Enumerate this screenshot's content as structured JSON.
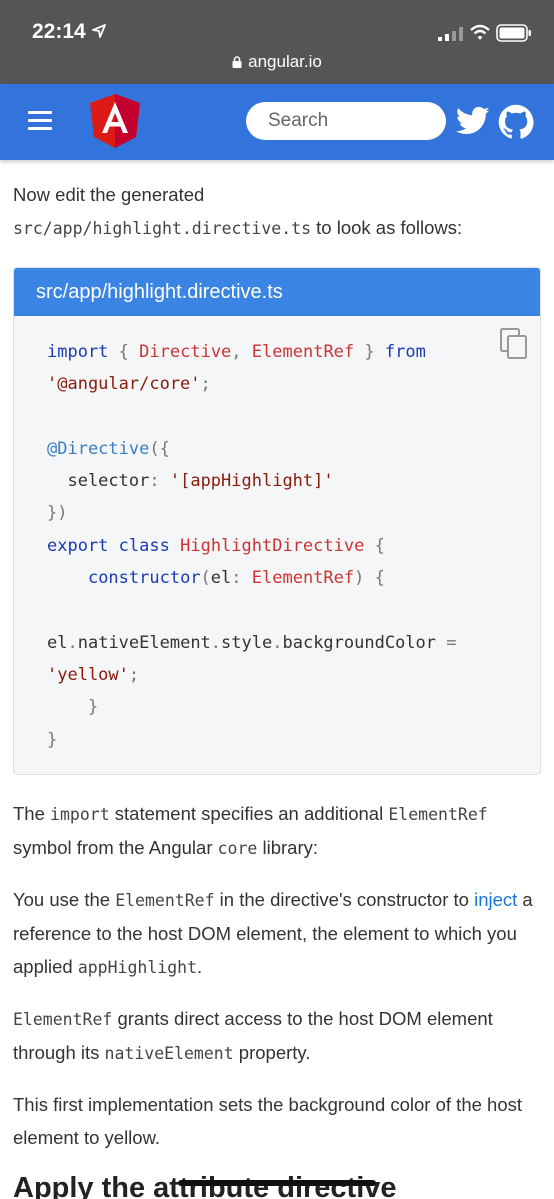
{
  "status": {
    "time": "22:14",
    "url": "angular.io"
  },
  "nav": {
    "search_placeholder": "Search"
  },
  "intro": {
    "text1": "Now edit the generated",
    "code": "src/app/highlight.directive.ts",
    "text2": " to look as follows:"
  },
  "code_block": {
    "title": "src/app/highlight.directive.ts",
    "lines": [
      "import { Directive, ElementRef } from",
      "'@angular/core';",
      "",
      "@Directive({",
      "  selector: '[appHighlight]'",
      "})",
      "export class HighlightDirective {",
      "    constructor(el: ElementRef) {",
      "",
      "el.nativeElement.style.backgroundColor =",
      "'yellow';",
      "    }",
      "}"
    ]
  },
  "p1": {
    "t1": "The ",
    "c1": "import",
    "t2": " statement specifies an additional ",
    "c2": "ElementRef",
    "t3": " symbol from the Angular ",
    "c3": "core",
    "t4": " library:"
  },
  "p2": {
    "t1": "You use the ",
    "c1": "ElementRef",
    "t2": " in the directive's constructor to ",
    "link": "inject",
    "t3": " a reference to the host DOM element, the element to which you applied ",
    "c2": "appHighlight",
    "t4": "."
  },
  "p3": {
    "c1": "ElementRef",
    "t1": " grants direct access to the host DOM element through its ",
    "c2": "nativeElement",
    "t2": " property."
  },
  "p4": {
    "text": "This first implementation sets the background color of the host element to yellow."
  },
  "heading": "Apply the attribute directive",
  "colors": {
    "status_bar": "#555555",
    "nav": "#3273dc",
    "code_header": "#3a84e3",
    "link": "#1976d2"
  }
}
